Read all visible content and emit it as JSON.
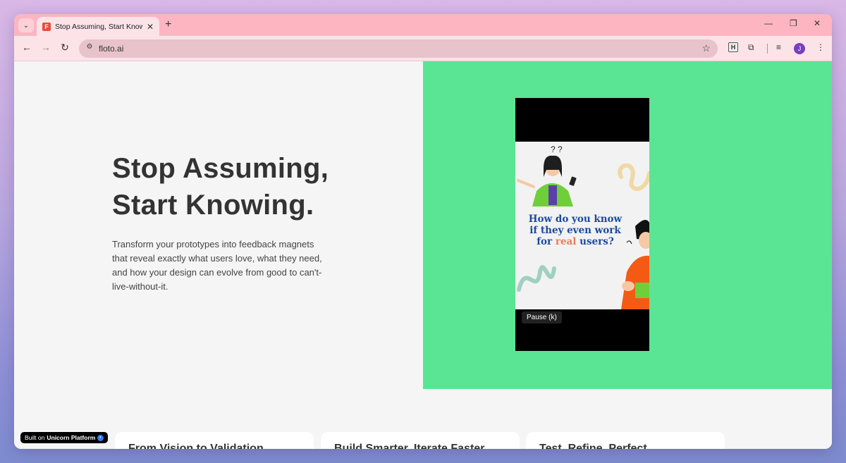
{
  "browser": {
    "tab_title": "Stop Assuming, Start Knowing.",
    "favicon_letter": "F",
    "url": "floto.ai",
    "profile_initial": "J",
    "extension_letter": "H",
    "tab_menu_glyph": "⌄",
    "tab_close_glyph": "✕",
    "new_tab_glyph": "+",
    "minimize_glyph": "—",
    "restore_glyph": "❐",
    "close_glyph": "✕",
    "back_glyph": "←",
    "forward_glyph": "→",
    "reload_glyph": "↻",
    "site_info_glyph": "⚙",
    "star_glyph": "☆",
    "extensions_glyph": "⧉",
    "media_glyph": "≡",
    "menu_glyph": "⋮"
  },
  "hero": {
    "title_line1": "Stop Assuming,",
    "title_line2": "Start Knowing.",
    "description": "Transform your prototypes into feedback magnets that reveal exactly what users love, what they need, and how your design can evolve from good to can't-live-without-it."
  },
  "video": {
    "line1": "How do you know",
    "line2": "if they even work",
    "line3_prefix": "for ",
    "line3_accent": "real",
    "line3_suffix": " users?",
    "question_marks": "? ?",
    "pause_tooltip": "Pause (k)"
  },
  "badge": {
    "prefix": "Built on",
    "brand": "Unicorn Platform"
  },
  "cards": [
    {
      "title": "From Vision to Validation"
    },
    {
      "title": "Build Smarter, Iterate Faster"
    },
    {
      "title": "Test, Refine, Perfect"
    }
  ],
  "colors": {
    "tabbar": "#fdb5c1",
    "green_panel": "#5ae595",
    "video_text": "#1c4aa0",
    "video_accent": "#f07a5c"
  }
}
